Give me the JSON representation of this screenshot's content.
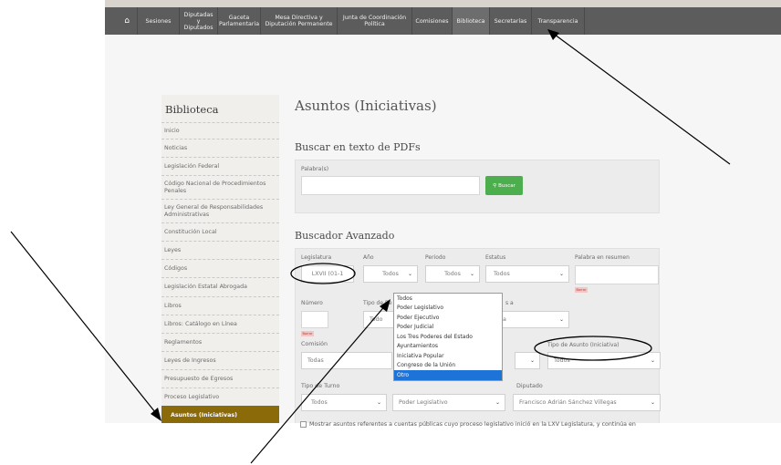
{
  "nav": {
    "items": [
      "Sesiones",
      "Diputadas y Diputados",
      "Gaceta Parlamentaria",
      "Mesa Directiva y Diputación Permanente",
      "Junta de Coordinación Política",
      "Comisiones",
      "Biblioteca",
      "Secretarías",
      "Transparencia"
    ],
    "active": "Biblioteca",
    "home_icon": "home-icon"
  },
  "sidebar": {
    "title": "Biblioteca",
    "items": [
      {
        "label": "Inicio"
      },
      {
        "label": "Noticias"
      },
      {
        "label": "Legislación Federal"
      },
      {
        "label": "Código Nacional de Procedimientos Penales"
      },
      {
        "label": "Ley General de Responsabilidades Administrativas"
      },
      {
        "label": "Constitución Local"
      },
      {
        "label": "Leyes"
      },
      {
        "label": "Códigos"
      },
      {
        "label": "Legislación Estatal Abrogada"
      },
      {
        "label": "Libros"
      },
      {
        "label": "Libros: Catálogo en Línea"
      },
      {
        "label": "Reglamentos"
      },
      {
        "label": "Leyes de Ingresos"
      },
      {
        "label": "Presupuesto de Egresos"
      },
      {
        "label": "Proceso Legislativo"
      },
      {
        "label": "Asuntos (Iniciativas)"
      }
    ],
    "active_index": 15
  },
  "main": {
    "title": "Asuntos (Iniciativas)",
    "pdf_search": {
      "title": "Buscar en texto de PDFs",
      "label": "Palabra(s)",
      "value": "",
      "button": "Buscar",
      "button_icon": "search-icon"
    },
    "advanced": {
      "title": "Buscador Avanzado",
      "legislatura": {
        "label": "Legislatura",
        "value": "LXVII (01-1"
      },
      "anio": {
        "label": "Año",
        "value": "Todos"
      },
      "periodo": {
        "label": "Periodo",
        "value": "Todos"
      },
      "estatus": {
        "label": "Estatus",
        "value": "Todos"
      },
      "palabra_resumen": {
        "label": "Palabra en resumen",
        "value": ""
      },
      "numero": {
        "label": "Número",
        "value": ""
      },
      "tipo_re": {
        "label": "Tipo de Re",
        "value": "Todo"
      },
      "fecha_a": {
        "label": "s a",
        "value": "a"
      },
      "comision": {
        "label": "Comisión",
        "value": "Todas"
      },
      "tipo_asunto": {
        "label": "Tipo de Asunto (Iniciativa)",
        "value": "Todos"
      },
      "tipo_turno": {
        "label": "Tipo de Turno",
        "value": "Todos"
      },
      "autor": {
        "label": "",
        "value": "Poder Legislativo"
      },
      "diputado": {
        "label": "Diputado",
        "value": "Francisco Adrián Sánchez Villegas"
      },
      "borrar": "Borrar",
      "checkbox_text": "Mostrar asuntos referentes a cuentas públicas cuyo proceso legislativo inició en la LXV Legislatura, y continúa en"
    },
    "dropdown": {
      "options": [
        "Todos",
        "Poder Legislativo",
        "Poder Ejecutivo",
        "Poder Judicial",
        "Los Tres Poderes del Estado",
        "Ayuntamientos",
        "Iniciativa Popular",
        "Congreso de la Unión",
        "Otro"
      ],
      "selected": "Otro"
    }
  },
  "colors": {
    "nav_bg": "#5c5c5c",
    "active_sidebar": "#8b6a0a",
    "buscar_button": "#4cae4c",
    "dropdown_highlight": "#1e73d9"
  }
}
